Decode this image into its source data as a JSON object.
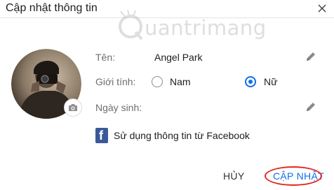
{
  "dialog": {
    "title": "Cập nhật thông tin",
    "close_icon": "close-icon"
  },
  "watermark": {
    "text": "uantrimang",
    "icon": "watermark-logo-icon"
  },
  "profile": {
    "name_label": "Tên:",
    "name_value": "Angel Park",
    "gender_label": "Giới tính:",
    "gender_options": [
      {
        "label": "Nam",
        "selected": false
      },
      {
        "label": "Nữ",
        "selected": true
      }
    ],
    "birthday_label": "Ngày sinh:",
    "birthday_value": ""
  },
  "facebook": {
    "label": "Sử dụng thông tin từ Facebook",
    "icon": "facebook-icon"
  },
  "actions": {
    "cancel_label": "HỦY",
    "update_label": "CẬP NHẬT"
  },
  "colors": {
    "accent": "#0f6fe6",
    "annotation_red": "#e8231c",
    "facebook_blue": "#3b5998"
  }
}
